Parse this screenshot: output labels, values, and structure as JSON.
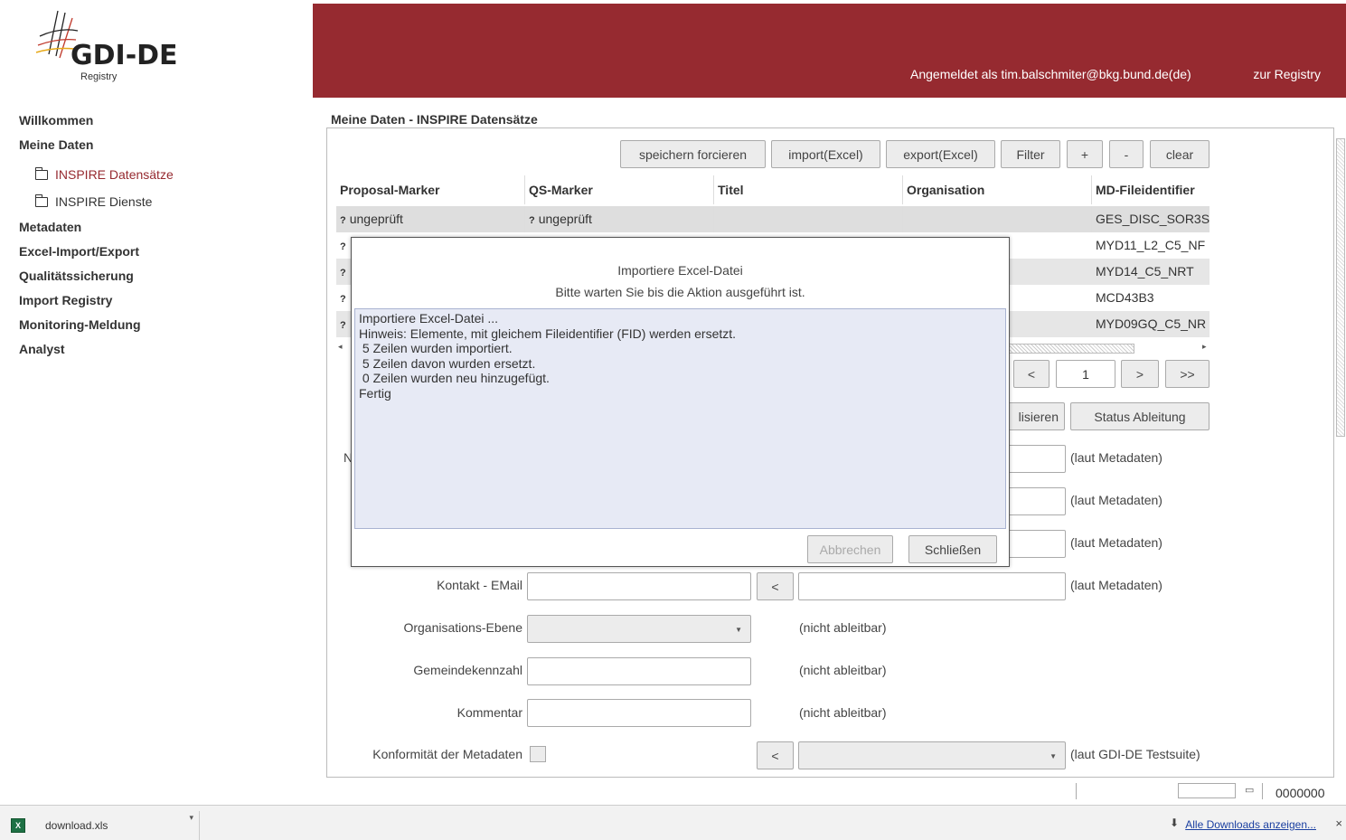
{
  "header": {
    "user_text": "Angemeldet als tim.balschmiter@bkg.bund.de(de)",
    "registry_link": "zur Registry",
    "bg_color": "#962a30"
  },
  "logo": {
    "brand": "GDI-DE",
    "sub": "Registry"
  },
  "nav": {
    "items": [
      "Willkommen",
      "Meine Daten",
      "Metadaten",
      "Excel-Import/Export",
      "Qualitätssicherung",
      "Import Registry",
      "Monitoring-Meldung",
      "Analyst"
    ],
    "sub_items": [
      "INSPIRE Datensätze",
      "INSPIRE Dienste"
    ]
  },
  "breadcrumb": "Meine Daten - INSPIRE Datensätze",
  "toolbar": {
    "force_save": "speichern forcieren",
    "import": "import(Excel)",
    "export": "export(Excel)",
    "filter": "Filter",
    "plus": "+",
    "minus": "-",
    "clear": "clear"
  },
  "table": {
    "columns": [
      "Proposal-Marker",
      "QS-Marker",
      "Titel",
      "Organisation",
      "MD-Fileidentifier"
    ],
    "rows": [
      {
        "proposal": "ungeprüft",
        "qs": "ungeprüft",
        "fid": "GES_DISC_SOR3S"
      },
      {
        "proposal": "",
        "qs": "",
        "fid": "MYD11_L2_C5_NF"
      },
      {
        "proposal": "",
        "qs": "",
        "fid": "MYD14_C5_NRT"
      },
      {
        "proposal": "",
        "qs": "",
        "fid": "MCD43B3"
      },
      {
        "proposal": "",
        "qs": "",
        "fid": "MYD09GQ_C5_NR"
      }
    ],
    "qmark": "?"
  },
  "pager": {
    "prev": "<",
    "page": "1",
    "next": ">",
    "last": ">>"
  },
  "actions": {
    "sync_partial": "lisieren",
    "status": "Status Ableitung"
  },
  "form": {
    "partial_label": "N",
    "contact_email": "Kontakt - EMail",
    "org_level": "Organisations-Ebene",
    "municipality": "Gemeindekennzahl",
    "comment": "Kommentar",
    "conformity": "Konformität der Metadaten",
    "copy_button": "<",
    "note_metadata": "(laut Metadaten)",
    "note_not_derivable": "(nicht ableitbar)",
    "note_testsuite": "(laut GDI-DE Testsuite)"
  },
  "dialog": {
    "title": "Importiere Excel-Datei",
    "subtitle": "Bitte warten Sie bis die Aktion ausgeführt ist.",
    "log": "Importiere Excel-Datei ...\nHinweis: Elemente, mit gleichem Fileidentifier (FID) werden ersetzt.\n 5 Zeilen wurden importiert.\n 5 Zeilen davon wurden ersetzt.\n 0 Zeilen wurden neu hinzugefügt.\nFertig",
    "cancel": "Abbrechen",
    "close": "Schließen"
  },
  "statusbar": {
    "code": "0000000"
  },
  "downloads": {
    "file": "download.xls",
    "show_all": "Alle Downloads anzeigen...",
    "close": "×"
  }
}
